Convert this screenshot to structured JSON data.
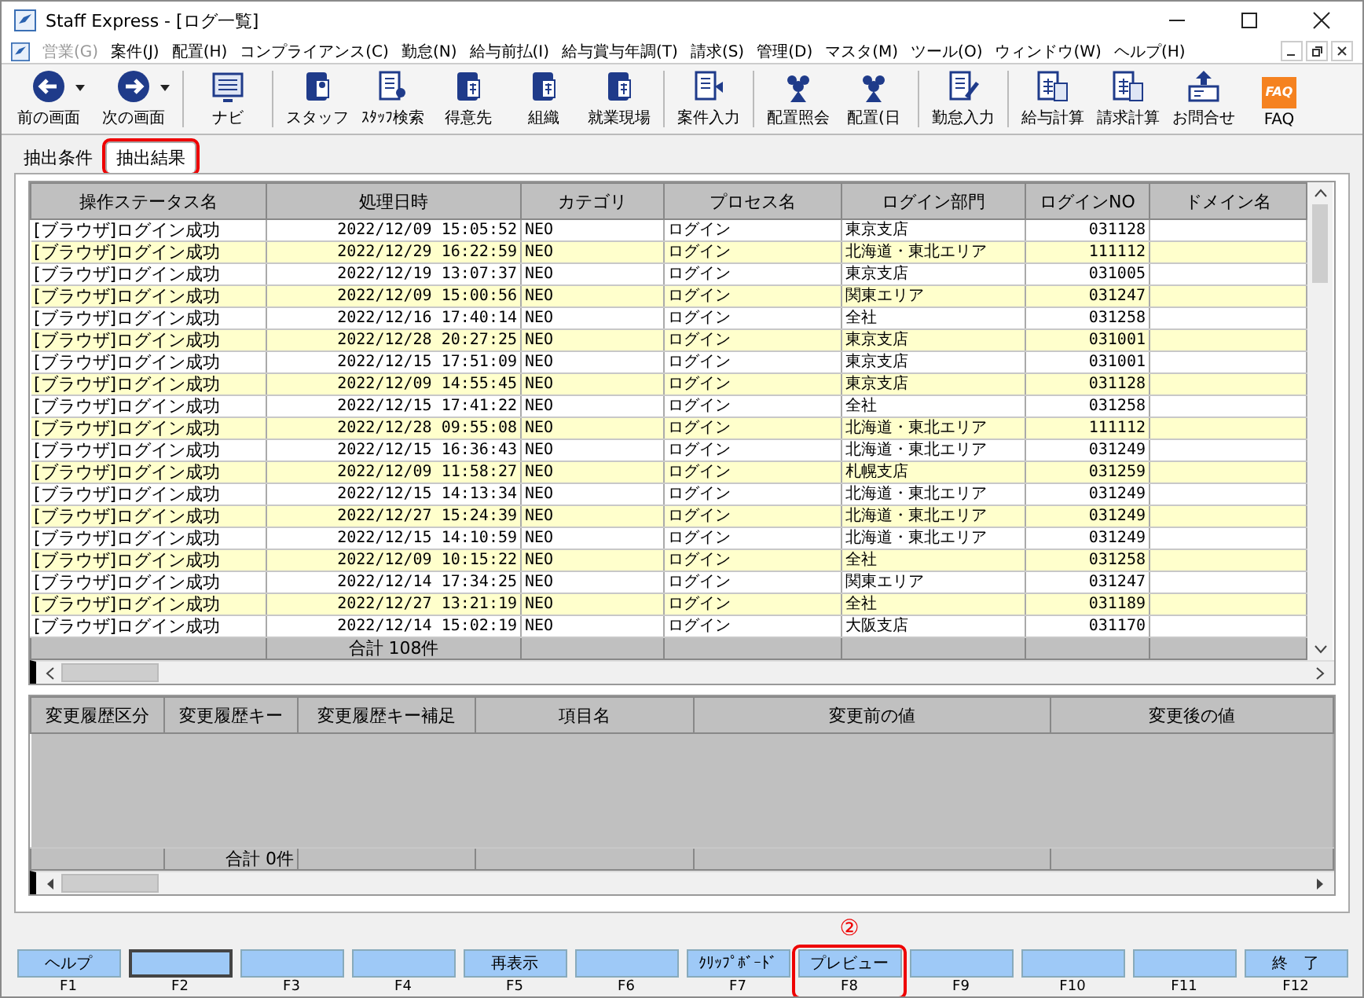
{
  "window": {
    "title": "Staff Express - [ログ一覧]"
  },
  "menu": [
    {
      "label": "営業(G)",
      "disabled": true
    },
    {
      "label": "案件(J)",
      "disabled": false
    },
    {
      "label": "配置(H)",
      "disabled": false
    },
    {
      "label": "コンプライアンス(C)",
      "disabled": false
    },
    {
      "label": "勤怠(N)",
      "disabled": false
    },
    {
      "label": "給与前払(I)",
      "disabled": false
    },
    {
      "label": "給与賞与年調(T)",
      "disabled": false
    },
    {
      "label": "請求(S)",
      "disabled": false
    },
    {
      "label": "管理(D)",
      "disabled": false
    },
    {
      "label": "マスタ(M)",
      "disabled": false
    },
    {
      "label": "ツール(O)",
      "disabled": false
    },
    {
      "label": "ウィンドウ(W)",
      "disabled": false
    },
    {
      "label": "ヘルプ(H)",
      "disabled": false
    }
  ],
  "toolbar": [
    [
      {
        "label": "前の画面",
        "kind": "back",
        "dropdown": true
      },
      {
        "label": "次の画面",
        "kind": "forward",
        "dropdown": true
      }
    ],
    [
      {
        "label": "ナビ",
        "kind": "screen",
        "dropdown": false
      }
    ],
    [
      {
        "label": "スタッフ",
        "kind": "person",
        "dropdown": false
      },
      {
        "label": "ｽﾀｯﾌ検索",
        "kind": "docperson",
        "dropdown": false
      },
      {
        "label": "得意先",
        "kind": "binder",
        "dropdown": false
      },
      {
        "label": "組織",
        "kind": "binder",
        "dropdown": false
      },
      {
        "label": "就業現場",
        "kind": "binder",
        "dropdown": false
      }
    ],
    [
      {
        "label": "案件入力",
        "kind": "form",
        "dropdown": false
      }
    ],
    [
      {
        "label": "配置照会",
        "kind": "group",
        "dropdown": false
      },
      {
        "label": "配置(日",
        "kind": "group",
        "dropdown": false
      }
    ],
    [
      {
        "label": "勤怠入力",
        "kind": "edit",
        "dropdown": false
      }
    ],
    [
      {
        "label": "給与計算",
        "kind": "calc",
        "dropdown": false
      },
      {
        "label": "請求計算",
        "kind": "calcdoc",
        "dropdown": false
      },
      {
        "label": "お問合せ",
        "kind": "upload",
        "dropdown": false
      },
      {
        "label": "FAQ",
        "kind": "faq",
        "dropdown": false,
        "badge": "FAQ"
      }
    ]
  ],
  "tabs": [
    {
      "label": "抽出条件",
      "selected": false,
      "highlighted": false
    },
    {
      "label": "抽出結果",
      "selected": true,
      "highlighted": true
    }
  ],
  "log_table": {
    "columns": [
      "操作ステータス名",
      "処理日時",
      "カテゴリ",
      "プロセス名",
      "ログイン部門",
      "ログインNO",
      "ドメイン名"
    ],
    "rows": [
      [
        "[ブラウザ]ログイン成功",
        "2022/12/09 15:05:52",
        "NEO",
        "ログイン",
        "東京支店",
        "031128"
      ],
      [
        "[ブラウザ]ログイン成功",
        "2022/12/29 16:22:59",
        "NEO",
        "ログイン",
        "北海道・東北エリア",
        "111112"
      ],
      [
        "[ブラウザ]ログイン成功",
        "2022/12/19 13:07:37",
        "NEO",
        "ログイン",
        "東京支店",
        "031005"
      ],
      [
        "[ブラウザ]ログイン成功",
        "2022/12/09 15:00:56",
        "NEO",
        "ログイン",
        "関東エリア",
        "031247"
      ],
      [
        "[ブラウザ]ログイン成功",
        "2022/12/16 17:40:14",
        "NEO",
        "ログイン",
        "全社",
        "031258"
      ],
      [
        "[ブラウザ]ログイン成功",
        "2022/12/28 20:27:25",
        "NEO",
        "ログイン",
        "東京支店",
        "031001"
      ],
      [
        "[ブラウザ]ログイン成功",
        "2022/12/15 17:51:09",
        "NEO",
        "ログイン",
        "東京支店",
        "031001"
      ],
      [
        "[ブラウザ]ログイン成功",
        "2022/12/09 14:55:45",
        "NEO",
        "ログイン",
        "東京支店",
        "031128"
      ],
      [
        "[ブラウザ]ログイン成功",
        "2022/12/15 17:41:22",
        "NEO",
        "ログイン",
        "全社",
        "031258"
      ],
      [
        "[ブラウザ]ログイン成功",
        "2022/12/28 09:55:08",
        "NEO",
        "ログイン",
        "北海道・東北エリア",
        "111112"
      ],
      [
        "[ブラウザ]ログイン成功",
        "2022/12/15 16:36:43",
        "NEO",
        "ログイン",
        "北海道・東北エリア",
        "031249"
      ],
      [
        "[ブラウザ]ログイン成功",
        "2022/12/09 11:58:27",
        "NEO",
        "ログイン",
        "札幌支店",
        "031259"
      ],
      [
        "[ブラウザ]ログイン成功",
        "2022/12/15 14:13:34",
        "NEO",
        "ログイン",
        "北海道・東北エリア",
        "031249"
      ],
      [
        "[ブラウザ]ログイン成功",
        "2022/12/27 15:24:39",
        "NEO",
        "ログイン",
        "北海道・東北エリア",
        "031249"
      ],
      [
        "[ブラウザ]ログイン成功",
        "2022/12/15 14:10:59",
        "NEO",
        "ログイン",
        "北海道・東北エリア",
        "031249"
      ],
      [
        "[ブラウザ]ログイン成功",
        "2022/12/09 10:15:22",
        "NEO",
        "ログイン",
        "全社",
        "031258"
      ],
      [
        "[ブラウザ]ログイン成功",
        "2022/12/14 17:34:25",
        "NEO",
        "ログイン",
        "関東エリア",
        "031247"
      ],
      [
        "[ブラウザ]ログイン成功",
        "2022/12/27 13:21:19",
        "NEO",
        "ログイン",
        "全社",
        "031189"
      ],
      [
        "[ブラウザ]ログイン成功",
        "2022/12/14 15:02:19",
        "NEO",
        "ログイン",
        "大阪支店",
        "031170"
      ]
    ],
    "total": "合計 108件"
  },
  "history_table": {
    "columns": [
      "変更履歴区分",
      "変更履歴キー",
      "変更履歴キー補足",
      "項目名",
      "変更前の値",
      "変更後の値"
    ],
    "total": "合計 0件"
  },
  "annotation": "②",
  "function_keys": [
    {
      "key": "F1",
      "label": "ヘルプ",
      "focused": false,
      "highlighted": false
    },
    {
      "key": "F2",
      "focused": true,
      "highlighted": false
    },
    {
      "key": "F3",
      "focused": false,
      "highlighted": false
    },
    {
      "key": "F4",
      "focused": false,
      "highlighted": false
    },
    {
      "key": "F5",
      "label": "再表示",
      "focused": false,
      "highlighted": false
    },
    {
      "key": "F6",
      "focused": false,
      "highlighted": false
    },
    {
      "key": "F7",
      "label": "ｸﾘｯﾌﾟﾎﾞｰﾄﾞ",
      "focused": false,
      "highlighted": false
    },
    {
      "key": "F8",
      "label": "プレビュー",
      "focused": false,
      "highlighted": true
    },
    {
      "key": "F9",
      "focused": false,
      "highlighted": false
    },
    {
      "key": "F10",
      "focused": false,
      "highlighted": false
    },
    {
      "key": "F11",
      "focused": false,
      "highlighted": false
    },
    {
      "key": "F12",
      "label": "終　了",
      "focused": false,
      "highlighted": false
    }
  ]
}
